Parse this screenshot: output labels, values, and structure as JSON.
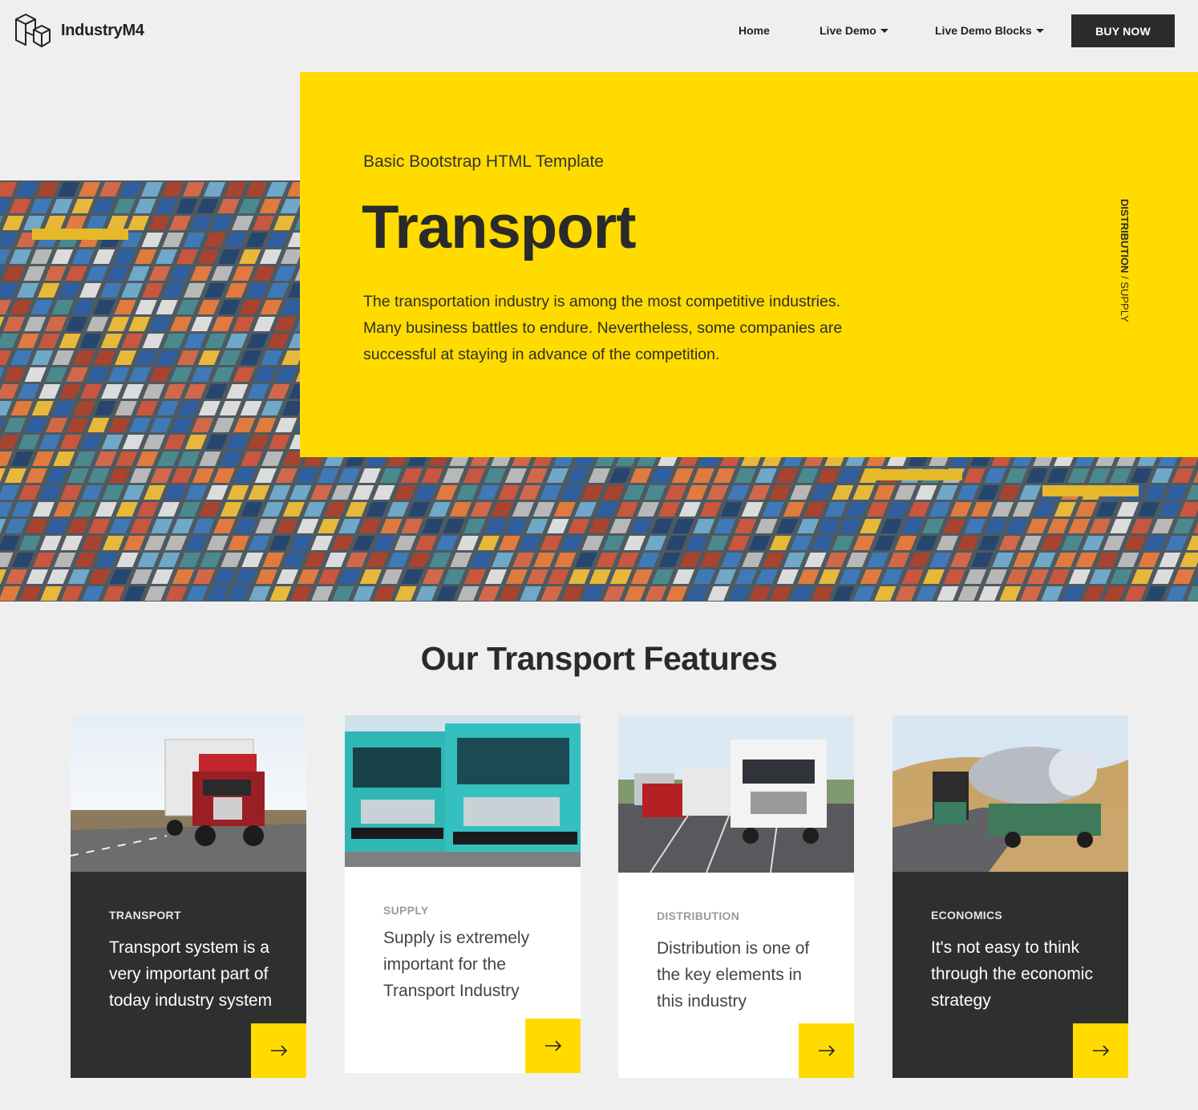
{
  "brand": {
    "name": "IndustryM4",
    "logo_icon": "cubes-logo-icon"
  },
  "nav": {
    "home": "Home",
    "live_demo": "Live Demo",
    "live_demo_blocks": "Live Demo Blocks",
    "buy_now": "BUY NOW"
  },
  "hero": {
    "subtitle": "Basic Bootstrap HTML Template",
    "title": "Transport",
    "description": "The transportation industry is among the most competitive industries. Many business battles to endure. Nevertheless, some companies are successful at staying in advance of the competition.",
    "vertical_bold": "DISTRIBUTION",
    "vertical_sep": " / ",
    "vertical_light": "SUPPLY",
    "image": "container-port-aerial-photo"
  },
  "features": {
    "title": "Our Transport Features",
    "cards": [
      {
        "tag": "TRANSPORT",
        "text": "Transport system is a very important part of today industry system",
        "image": "red-truck-photo",
        "arrow_icon": "arrow-right-icon"
      },
      {
        "tag": "SUPPLY",
        "text": "Supply is  extremely important for the Transport Industry",
        "image": "teal-trucks-photo",
        "arrow_icon": "arrow-right-icon"
      },
      {
        "tag": "DISTRIBUTION",
        "text": "Distribution is one of the key elements in this industry",
        "image": "parked-trucks-photo",
        "arrow_icon": "arrow-right-icon"
      },
      {
        "tag": "ECONOMICS",
        "text": "It's not easy to think through the economic strategy",
        "image": "tanker-truck-photo",
        "arrow_icon": "arrow-right-icon"
      }
    ]
  },
  "colors": {
    "accent": "#ffdb00",
    "dark": "#2f2f2f",
    "background": "#efefef"
  }
}
